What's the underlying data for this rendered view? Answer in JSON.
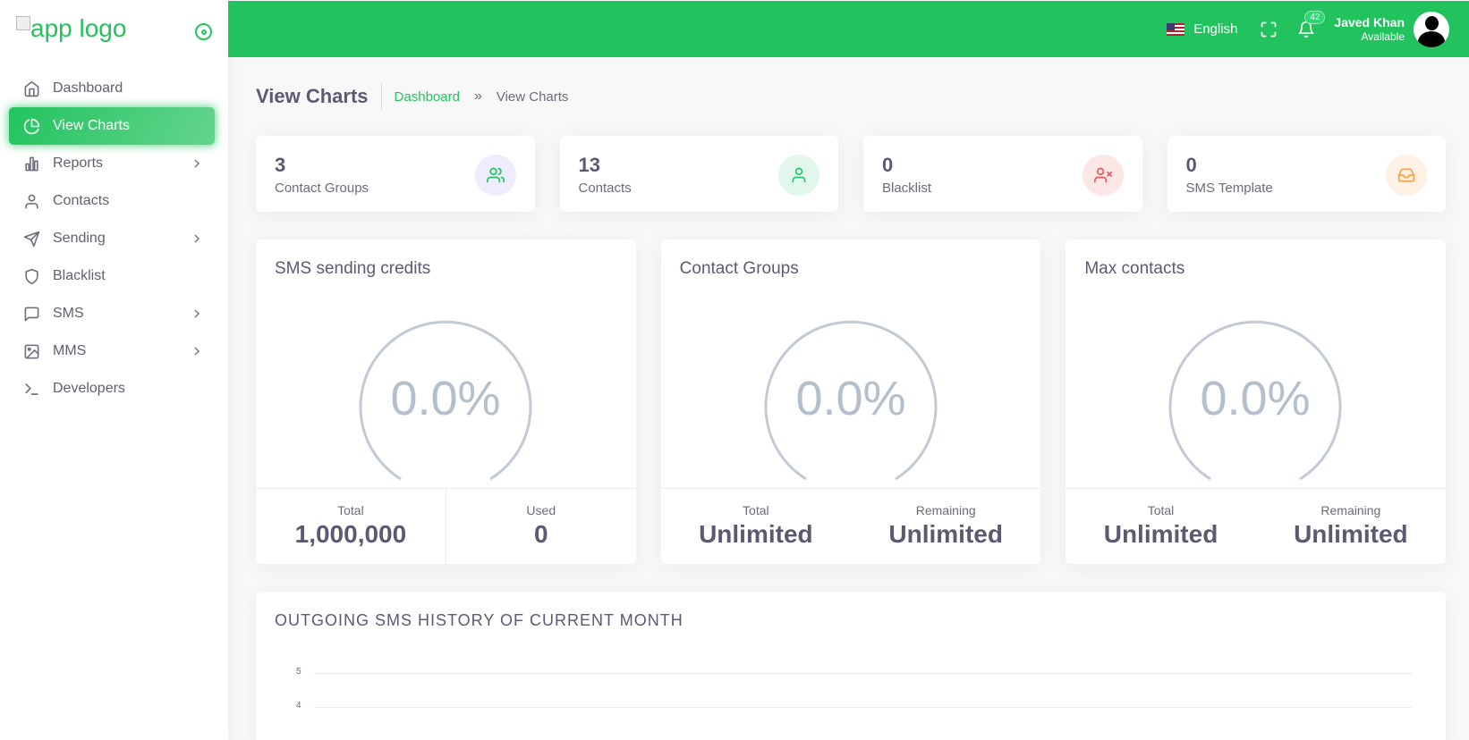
{
  "brand": {
    "logo_alt": "app logo"
  },
  "sidebar": {
    "items": [
      {
        "label": "Dashboard",
        "icon": "home-icon"
      },
      {
        "label": "View Charts",
        "icon": "pie-chart-icon",
        "active": true
      },
      {
        "label": "Reports",
        "icon": "bar-chart-icon",
        "has_children": true
      },
      {
        "label": "Contacts",
        "icon": "user-icon"
      },
      {
        "label": "Sending",
        "icon": "send-icon",
        "has_children": true
      },
      {
        "label": "Blacklist",
        "icon": "shield-icon"
      },
      {
        "label": "SMS",
        "icon": "message-square-icon",
        "has_children": true
      },
      {
        "label": "MMS",
        "icon": "image-icon",
        "has_children": true
      },
      {
        "label": "Developers",
        "icon": "terminal-icon"
      }
    ]
  },
  "navbar": {
    "language": "English",
    "notification_count": "42",
    "user_name": "Javed Khan",
    "user_status": "Available"
  },
  "page": {
    "title": "View Charts",
    "breadcrumb": {
      "link": "Dashboard",
      "separator": "»",
      "current": "View Charts"
    }
  },
  "stats": [
    {
      "value": "3",
      "label": "Contact Groups",
      "icon": "users-icon"
    },
    {
      "value": "13",
      "label": "Contacts",
      "icon": "user-icon"
    },
    {
      "value": "0",
      "label": "Blacklist",
      "icon": "user-x-icon"
    },
    {
      "value": "0",
      "label": "SMS Template",
      "icon": "inbox-icon"
    }
  ],
  "gauges": [
    {
      "title": "SMS sending credits",
      "percent": "0.0%",
      "left_label": "Total",
      "left_value": "1,000,000",
      "right_label": "Used",
      "right_value": "0"
    },
    {
      "title": "Contact Groups",
      "percent": "0.0%",
      "left_label": "Total",
      "left_value": "Unlimited",
      "right_label": "Remaining",
      "right_value": "Unlimited"
    },
    {
      "title": "Max contacts",
      "percent": "0.0%",
      "left_label": "Total",
      "left_value": "Unlimited",
      "right_label": "Remaining",
      "right_value": "Unlimited"
    }
  ],
  "history": {
    "title": "OUTGOING SMS HISTORY OF CURRENT MONTH",
    "y_ticks": [
      "5",
      "4"
    ]
  },
  "colors": {
    "primary": "#22c35e",
    "gauge_track": "#c2cad6",
    "gauge_text": "#b4bfcd"
  }
}
